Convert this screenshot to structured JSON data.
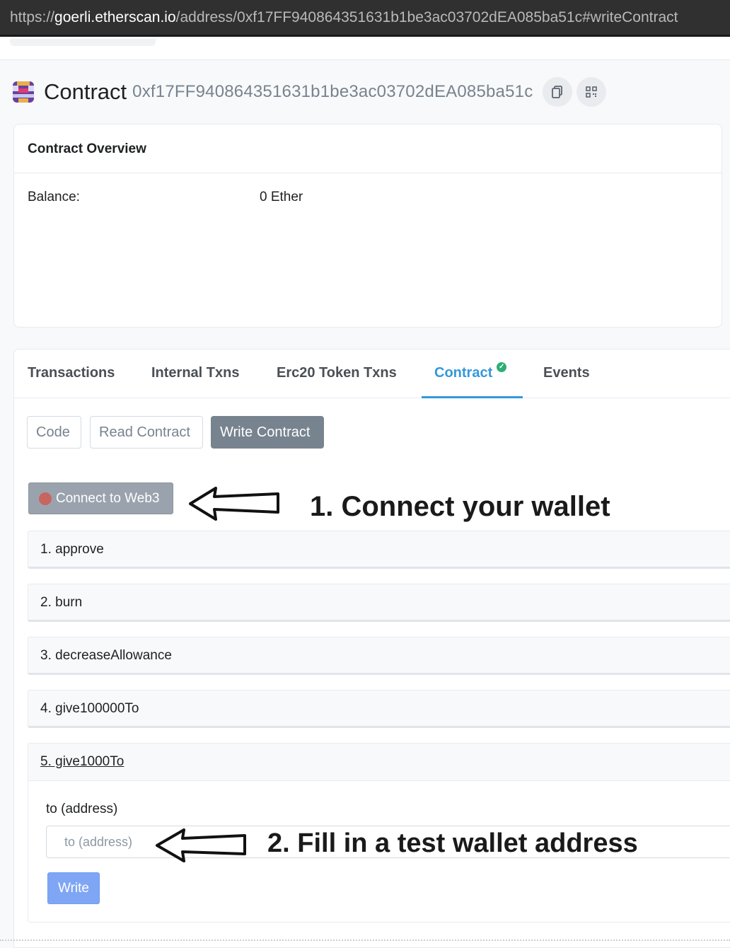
{
  "browser": {
    "url_protocol": "https://",
    "url_host": "goerli.etherscan.io",
    "url_path": "/address/0xf17FF940864351631b1be3ac03702dEA085ba51c#writeContract"
  },
  "header": {
    "contract_label": "Contract",
    "contract_address": "0xf17FF940864351631b1be3ac03702dEA085ba51c",
    "copy_icon": "copy-icon",
    "qr_icon": "qr-code-icon"
  },
  "overview": {
    "title": "Contract Overview",
    "balance_label": "Balance:",
    "balance_value": "0 Ether"
  },
  "tabs": [
    {
      "label": "Transactions"
    },
    {
      "label": "Internal Txns"
    },
    {
      "label": "Erc20 Token Txns"
    },
    {
      "label": "Contract",
      "verified_icon": "check-circle-icon",
      "active": true
    },
    {
      "label": "Events"
    }
  ],
  "subtabs": [
    {
      "label": "Code"
    },
    {
      "label": "Read Contract"
    },
    {
      "label": "Write Contract",
      "active": true
    }
  ],
  "web3": {
    "label": "Connect to Web3",
    "status_color": "#de4437"
  },
  "annotations": {
    "step1": "1. Connect your wallet",
    "step2": "2. Fill in a test wallet address"
  },
  "functions": [
    {
      "label": "1. approve"
    },
    {
      "label": "2. burn"
    },
    {
      "label": "3. decreaseAllowance"
    },
    {
      "label": "4. give100000To"
    },
    {
      "label": "5. give1000To",
      "expanded": true,
      "param_label": "to (address)",
      "param_placeholder": "to (address)",
      "write_label": "Write"
    }
  ],
  "colors": {
    "accent": "#3498db",
    "verified": "#2eae75",
    "write_button": "#7fa6f5",
    "muted_button": "#77838f"
  }
}
